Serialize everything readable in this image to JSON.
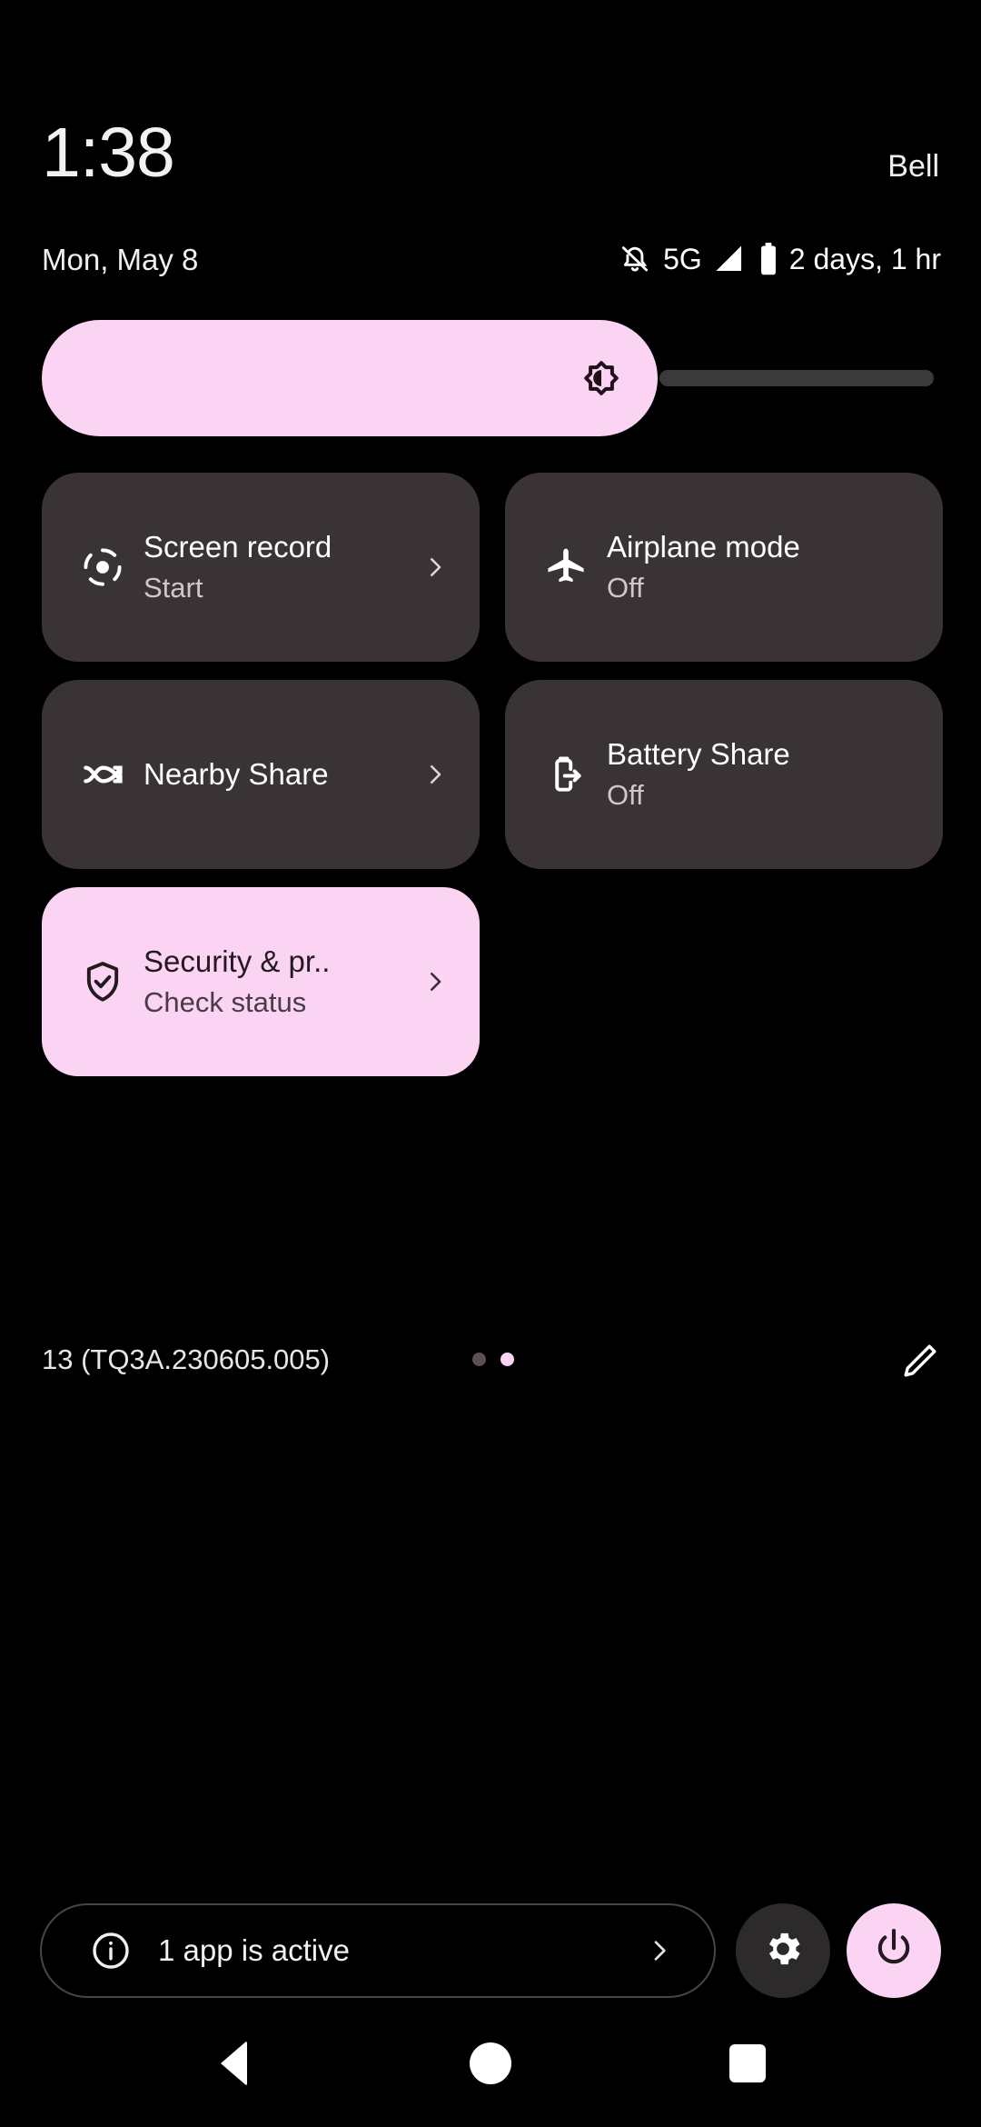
{
  "statusbar": {
    "time": "1:38",
    "carrier": "Bell",
    "date": "Mon, May 8",
    "network_type": "5G",
    "battery_estimate": "2 days, 1 hr",
    "icons": {
      "mute": "bell-mute-icon",
      "signal": "signal-bar-icon",
      "battery": "battery-icon"
    }
  },
  "brightness": {
    "name": "brightness-slider",
    "icon": "brightness-icon",
    "value_percent": 68
  },
  "tiles": [
    {
      "name": "tile-screen-record",
      "title": "Screen record",
      "subtitle": "Start",
      "icon": "screen-record-icon",
      "has_chevron": true,
      "active": false
    },
    {
      "name": "tile-airplane-mode",
      "title": "Airplane mode",
      "subtitle": "Off",
      "icon": "airplane-icon",
      "has_chevron": false,
      "active": false
    },
    {
      "name": "tile-nearby-share",
      "title": "Nearby Share",
      "subtitle": "",
      "icon": "nearby-share-icon",
      "has_chevron": true,
      "active": false
    },
    {
      "name": "tile-battery-share",
      "title": "Battery Share",
      "subtitle": "Off",
      "icon": "battery-share-icon",
      "has_chevron": false,
      "active": false
    },
    {
      "name": "tile-security-privacy",
      "title": "Security & pr..",
      "subtitle": "Check status",
      "icon": "shield-check-icon",
      "has_chevron": true,
      "active": true
    }
  ],
  "meta": {
    "build": "13 (TQ3A.230605.005)",
    "pages": 2,
    "active_page": 2,
    "edit_icon": "pencil-edit-icon"
  },
  "footer": {
    "active_apps_label": "1 app is active",
    "info_icon": "info-icon",
    "chevron_icon": "chevron-right-icon",
    "settings_icon": "gear-icon",
    "power_icon": "power-icon"
  },
  "navbar": {
    "back": "back-triangle-icon",
    "home": "home-circle-icon",
    "recents": "recents-square-icon"
  },
  "colors": {
    "background": "#000000",
    "tile": "#3a3336",
    "accent": "#fbd4f4",
    "accent_text": "#24191f",
    "secondary_text": "#cfc8cb"
  }
}
